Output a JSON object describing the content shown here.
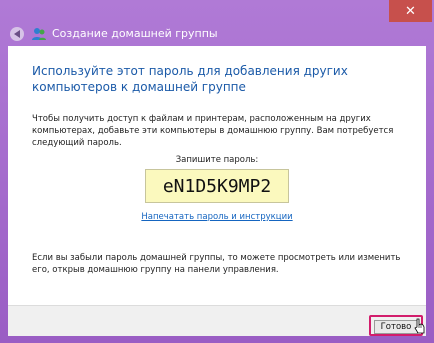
{
  "window": {
    "title": "Создание домашней группы",
    "close_label": "✕"
  },
  "content": {
    "heading": "Используйте этот пароль для добавления других компьютеров к домашней группе",
    "paragraph": "Чтобы получить доступ к файлам и принтерам, расположенным на других компьютерах, добавьте эти компьютеры в домашнюю группу. Вам потребуется следующий пароль.",
    "password_label": "Запишите пароль:",
    "password_value": "eN1D5K9MP2",
    "print_link": "Напечатать пароль и инструкции",
    "footer_text": "Если вы забыли пароль домашней группы, то можете просмотреть или изменить его, открыв домашнюю группу на панели управления."
  },
  "buttons": {
    "done": "Готово"
  },
  "icons": {
    "back": "back-arrow-icon",
    "homegroup": "homegroup-icon",
    "cursor": "mouse-pointer-icon"
  },
  "colors": {
    "window_frame": "#a166c8",
    "close_button": "#c7504c",
    "heading": "#1b5aa8",
    "password_box": "#fbf9be",
    "done_highlight": "#d21d6c"
  }
}
